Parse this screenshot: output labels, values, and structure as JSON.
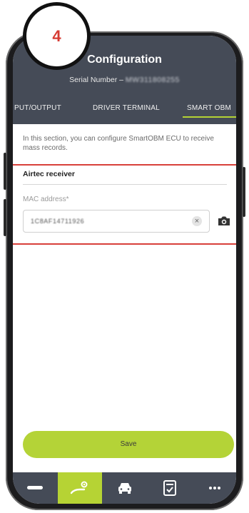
{
  "step_badge": "4",
  "header": {
    "title": "Configuration",
    "serial_label": "Serial Number –",
    "serial_value": "MW311808255"
  },
  "tabs": [
    {
      "label": "PUT/OUTPUT",
      "active": false
    },
    {
      "label": "DRIVER TERMINAL",
      "active": false
    },
    {
      "label": "SMART OBM",
      "active": true
    }
  ],
  "content": {
    "intro": "In this section, you can configure SmartOBM ECU to receive mass records.",
    "section_title": "Airtec receiver",
    "mac": {
      "label": "MAC address*",
      "value": "1C8AF14711926"
    }
  },
  "save_label": "Save",
  "bottom_nav": [
    {
      "icon": "minus-icon",
      "active": false
    },
    {
      "icon": "user-settings-icon",
      "active": true
    },
    {
      "icon": "car-icon",
      "active": false
    },
    {
      "icon": "checklist-icon",
      "active": false
    },
    {
      "icon": "more-icon",
      "active": false
    }
  ],
  "colors": {
    "header_bg": "#454b57",
    "accent": "#b5d334",
    "highlight": "#d8403a",
    "badge_text": "#d63b33"
  }
}
